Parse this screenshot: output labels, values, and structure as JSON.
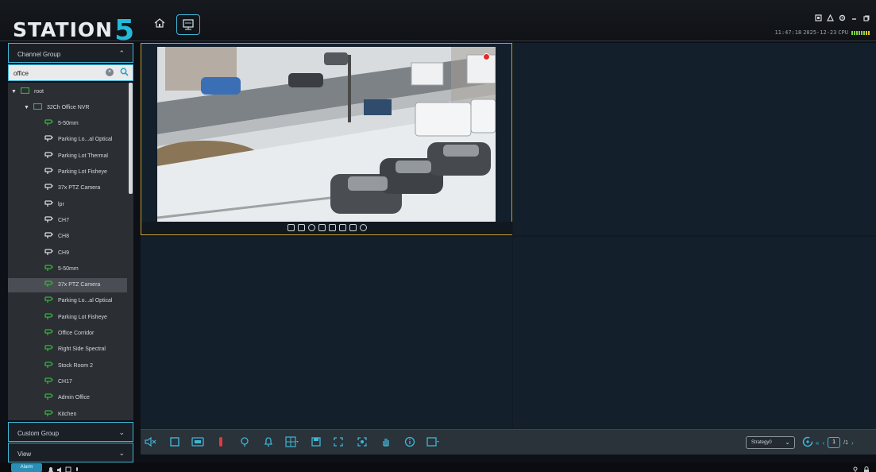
{
  "app": {
    "logo_text": "STATION",
    "logo_number": "5"
  },
  "status": {
    "time": "11:47:18",
    "date": "2025-12-23",
    "cpu_label": "CPU"
  },
  "sidebar": {
    "channel_group_label": "Channel Group",
    "search_value": "office",
    "custom_group_label": "Custom Group",
    "view_label": "View",
    "tree": [
      {
        "label": "root",
        "level": 0,
        "type": "folder"
      },
      {
        "label": "32Ch Office NVR",
        "level": 1,
        "type": "nvr"
      },
      {
        "label": "5-50mm",
        "level": 2,
        "type": "cam-online"
      },
      {
        "label": "Parking Lo...al Optical",
        "level": 2,
        "type": "cam-offline"
      },
      {
        "label": "Parking Lot Thermal",
        "level": 2,
        "type": "cam-offline"
      },
      {
        "label": "Parking Lot Fisheye",
        "level": 2,
        "type": "cam-offline"
      },
      {
        "label": "37x PTZ Camera",
        "level": 2,
        "type": "cam-offline"
      },
      {
        "label": "lpr",
        "level": 2,
        "type": "cam-offline"
      },
      {
        "label": "CH7",
        "level": 2,
        "type": "cam-offline"
      },
      {
        "label": "CH8",
        "level": 2,
        "type": "cam-offline"
      },
      {
        "label": "CH9",
        "level": 2,
        "type": "cam-offline"
      },
      {
        "label": "5-50mm",
        "level": 2,
        "type": "cam-online"
      },
      {
        "label": "37x PTZ Camera",
        "level": 2,
        "type": "cam-online",
        "selected": true
      },
      {
        "label": "Parking Lo...al Optical",
        "level": 2,
        "type": "cam-online"
      },
      {
        "label": "Parking Lot Fisheye",
        "level": 2,
        "type": "cam-online"
      },
      {
        "label": "Office Corridor",
        "level": 2,
        "type": "cam-online"
      },
      {
        "label": "Right Side Spectral",
        "level": 2,
        "type": "cam-online"
      },
      {
        "label": "Stock Room 2",
        "level": 2,
        "type": "cam-online"
      },
      {
        "label": "CH17",
        "level": 2,
        "type": "cam-online"
      },
      {
        "label": "Admin Office",
        "level": 2,
        "type": "cam-online"
      },
      {
        "label": "Kitchen",
        "level": 2,
        "type": "cam-online"
      }
    ]
  },
  "toolbar": {
    "strategy_value": "Strategy0",
    "current_page": "1",
    "total_pages": "/1"
  },
  "statusbar": {
    "alarm_label": "Alarm"
  },
  "colors": {
    "accent": "#3fb6d6",
    "online_camera": "#37b23a",
    "active_cell_border": "#c2a235"
  }
}
